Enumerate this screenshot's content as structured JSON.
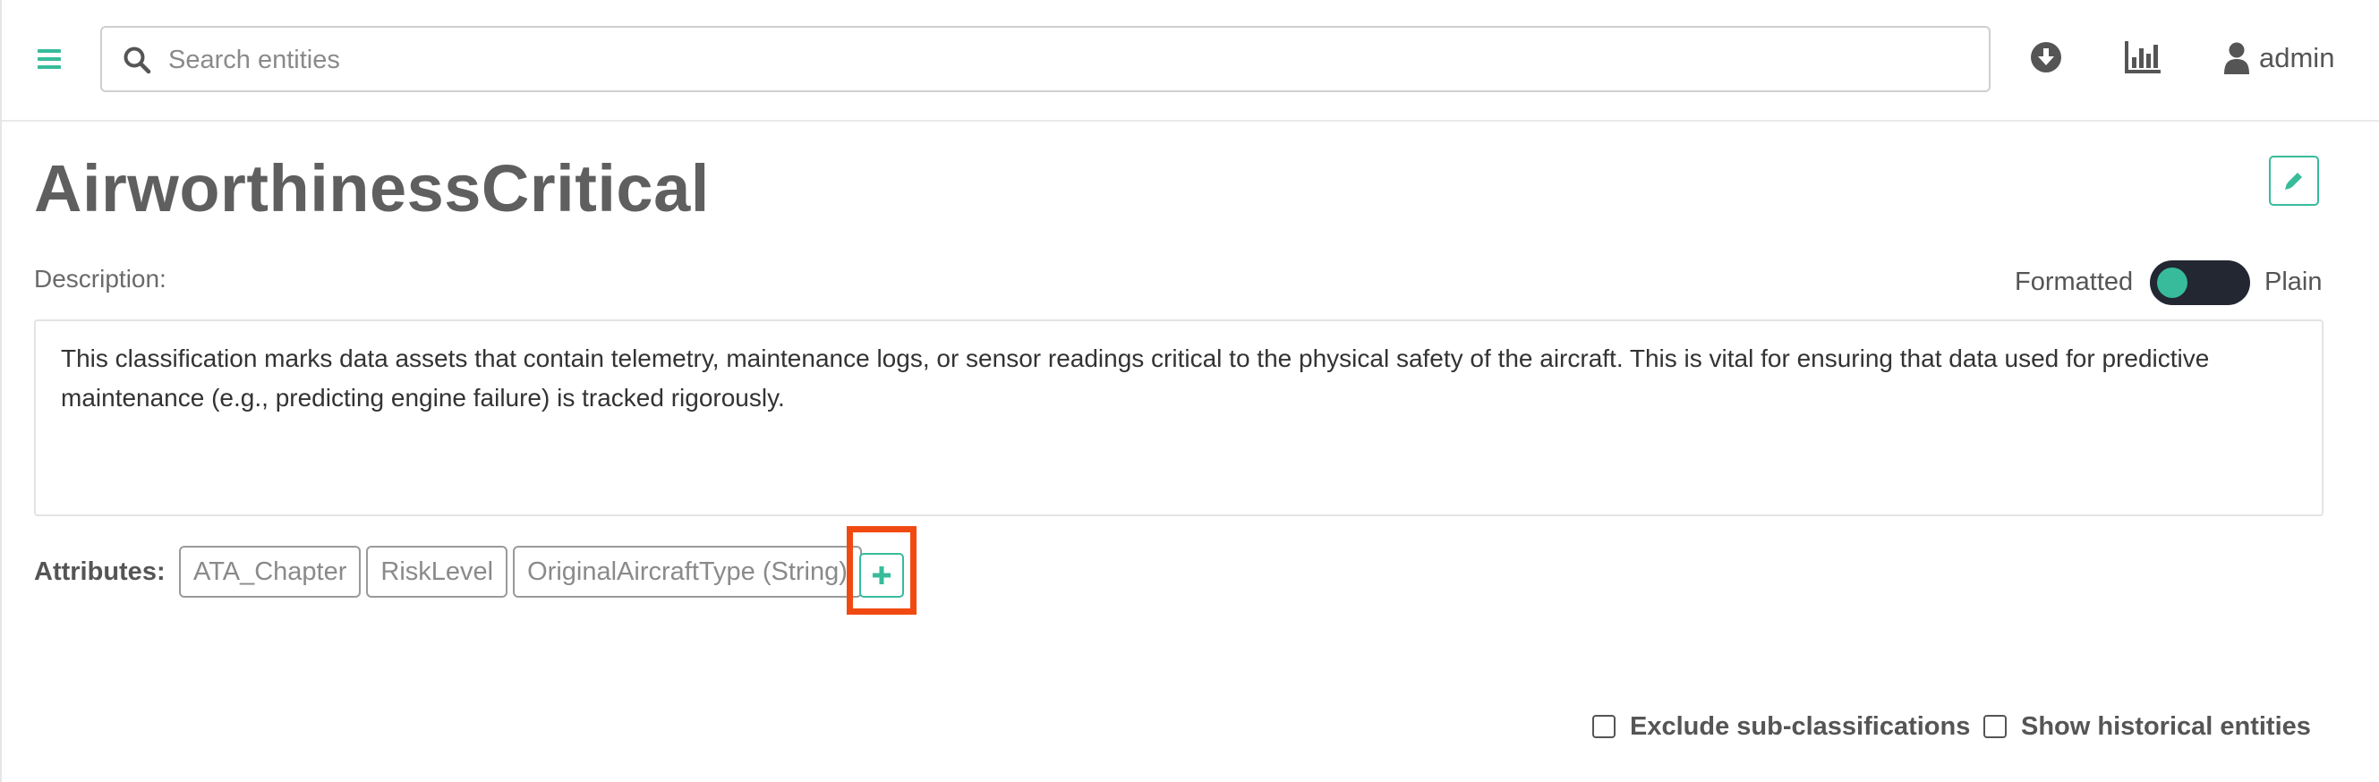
{
  "header": {
    "search_placeholder": "Search entities",
    "user_name": "admin",
    "icons": {
      "menu": "hamburger-icon",
      "search": "search-icon",
      "download": "download-circle-icon",
      "stats": "bar-chart-icon",
      "user": "user-icon"
    }
  },
  "classification": {
    "name": "AirworthinessCritical",
    "description_label": "Description:",
    "description_text": "This classification marks data assets that contain telemetry, maintenance logs, or sensor readings critical to the physical safety of the aircraft. This is vital for ensuring that data used for predictive maintenance (e.g., predicting engine failure) is tracked rigorously."
  },
  "format_toggle": {
    "left_label": "Formatted",
    "right_label": "Plain"
  },
  "attributes": {
    "label": "Attributes:",
    "items": [
      "ATA_Chapter",
      "RiskLevel",
      "OriginalAircraftType (String)"
    ]
  },
  "filters": {
    "exclude_sub": "Exclude sub-classifications",
    "show_historical": "Show historical entities"
  },
  "colors": {
    "accent": "#37bb9b",
    "highlight": "#f04a12",
    "toggle_track": "#222732"
  }
}
